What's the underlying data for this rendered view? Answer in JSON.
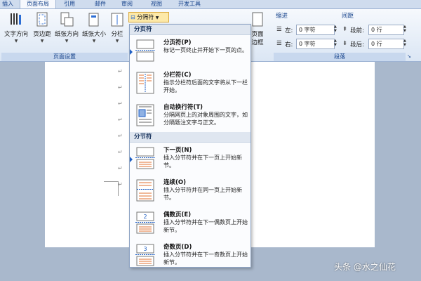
{
  "tabs": [
    "插入",
    "页面布局",
    "引用",
    "邮件",
    "审阅",
    "视图",
    "开发工具"
  ],
  "ribbon": {
    "buttons": {
      "text_direction": "文字方向",
      "margins": "页边距",
      "orientation": "纸张方向",
      "size": "纸张大小",
      "columns": "分栏",
      "breaks": "分隔符",
      "page_border_line1": "页面",
      "page_border_line2": "边框"
    },
    "groups": {
      "page_setup": "页面设置",
      "paragraph": "段落"
    },
    "indent": {
      "title": "缩进",
      "left_label": "左:",
      "left_value": "0 字符",
      "right_label": "右:",
      "right_value": "0 字符"
    },
    "spacing": {
      "title": "间距",
      "before_label": "段前:",
      "before_value": "0 行",
      "after_label": "段后:",
      "after_value": "0 行"
    }
  },
  "menu": {
    "section_page": "分页符",
    "section_section": "分节符",
    "items": [
      {
        "title": "分页符(P)",
        "desc": "标记一页终止并开始下一页的点。"
      },
      {
        "title": "分栏符(C)",
        "desc": "指示分栏符后面的文字将从下一栏开始。"
      },
      {
        "title": "自动换行符(T)",
        "desc": "分隔网页上的对象周围的文字，如分隔题注文字与正文。"
      },
      {
        "title": "下一页(N)",
        "desc": "插入分节符并在下一页上开始新节。"
      },
      {
        "title": "连续(O)",
        "desc": "插入分节符并在同一页上开始新节。"
      },
      {
        "title": "偶数页(E)",
        "desc": "插入分节符并在下一偶数页上开始新节。",
        "icon_digit": "2"
      },
      {
        "title": "奇数页(D)",
        "desc": "插入分节符并在下一奇数页上开始新节。",
        "icon_digit": "3"
      }
    ]
  },
  "watermark": "头条 @水之仙花",
  "colors": {
    "accent": "#15428b",
    "selected": "#1f5fc4"
  }
}
